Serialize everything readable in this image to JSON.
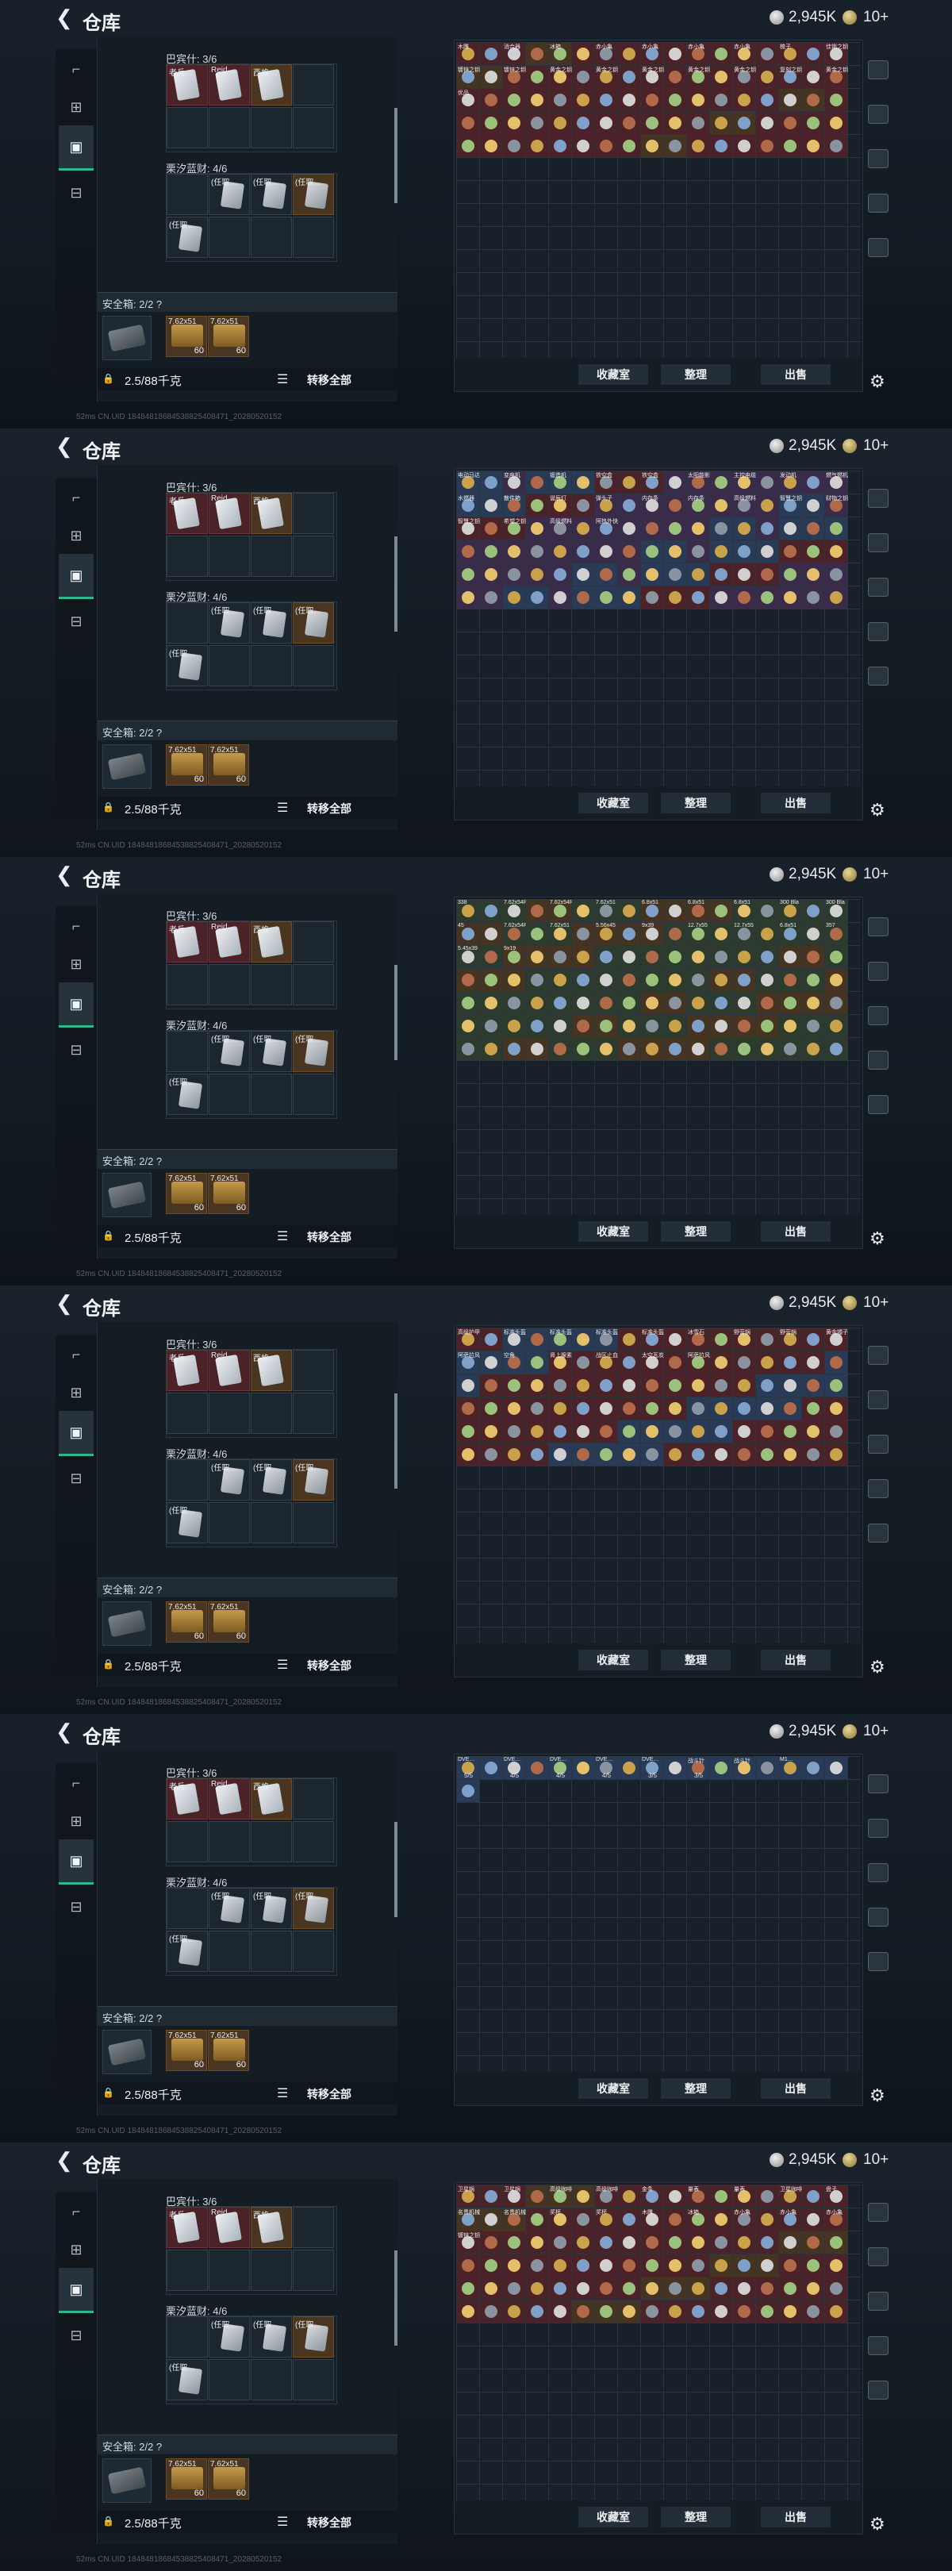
{
  "header": {
    "title": "仓库",
    "back_icon": "back-arrow-icon",
    "money": "2,945K",
    "gold": "10+"
  },
  "rail": {
    "items": [
      "gun-icon",
      "armor-icon",
      "backpack-icon",
      "toolbox-icon"
    ]
  },
  "loadout": {
    "pocket_label": "巴宾什: 3/6",
    "item_labels": [
      "老兵…",
      "Reid…",
      "西格…"
    ],
    "vest_label": "栗汐蓝财: 4/6",
    "vest_items": [
      "(任取…",
      "(任取…",
      "(任取…",
      "(任取…"
    ],
    "safe_label": "安全箱: 2/2 ?",
    "safe_items": [
      {
        "name": "7.62x51",
        "qty": "60"
      },
      {
        "name": "7.62x51",
        "qty": "60"
      }
    ],
    "capacity": "2.5/88千克",
    "move_all": "转移全部"
  },
  "storage": {
    "buttons": [
      "收藏室",
      "整理",
      "出售"
    ],
    "screens": [
      {
        "labels": [
          "木雕",
          "消合器",
          "冰箱",
          "赤小亀",
          "赤小亀",
          "赤小亀",
          "赤小亀",
          "梳子",
          "佳锁之钥",
          "镀锌之钥",
          "镀锌之钥",
          "黄金之钥",
          "黄金之钥",
          "黄金之钥",
          "黄金之钥",
          "黄金之钥",
          "复刻之钥",
          "黄金之钥",
          "优品"
        ]
      },
      {
        "labels": [
          "电动马达",
          "变座机",
          "锻造机",
          "铁空盒",
          "铁空盒",
          "太阳能影机",
          "主控电缆",
          "发动机",
          "燃气燃机",
          "水燃器",
          "散件箱",
          "诞辰灯",
          "弹头子",
          "内存条",
          "内存条",
          "高级燃料",
          "智慧之钥",
          "财物之钥",
          "智慧之钥",
          "希望之钥",
          "高级燃料",
          "阿热外快"
        ]
      },
      {
        "labels": [
          "338",
          "7.62x54R",
          "7.62x54R",
          "7.62x51",
          "6.8x51",
          "6.8x51",
          "6.8x51",
          "300 Bla",
          "300 Bla",
          "45",
          "7.62x54R",
          "7.62x51",
          "5.56x45",
          "9x39",
          "12.7x55",
          "12.7x55",
          "6.8x51",
          "357",
          "5.45x39",
          "9x19"
        ]
      },
      {
        "labels": [
          "高级护甲",
          "标准头盔",
          "标准头盔",
          "标准头盔",
          "标准头盔",
          "冰雪石",
          "野营锅",
          "野营锅",
          "黄金镯子",
          "阿萨拉风情",
          "空角",
          "肾上腺素",
          "战区止血带",
          "太空瓦炭",
          "阿萨拉风情"
        ]
      },
      {
        "labels": [
          "DVE…",
          "DVE…",
          "DVE…",
          "DVE…",
          "DVE…",
          "战斗针",
          "战斗针",
          "M1…"
        ],
        "counts": [
          "5/5",
          "4/5",
          "4/5",
          "4/5",
          "3/5",
          "3/5"
        ]
      },
      {
        "labels": [
          "卫星锅",
          "卫星锅",
          "高级咖啡豆",
          "高级咖啡豆",
          "金条",
          "量表",
          "量表",
          "卫星咖啡",
          "盘子",
          "名贵机械表",
          "名贵机械表",
          "奖杯",
          "奖杯",
          "木雕",
          "冰箱",
          "赤小亀",
          "赤小亀",
          "赤小亀",
          "镀锌之钥"
        ]
      }
    ]
  },
  "side_icons": [
    "helmet-icon",
    "armor-icon",
    "ammo-icon",
    "medical-icon",
    "key-icon",
    "gear-icon"
  ],
  "status": {
    "text": "52ms   CN.UID 18484818684538825408471_20280520152"
  }
}
